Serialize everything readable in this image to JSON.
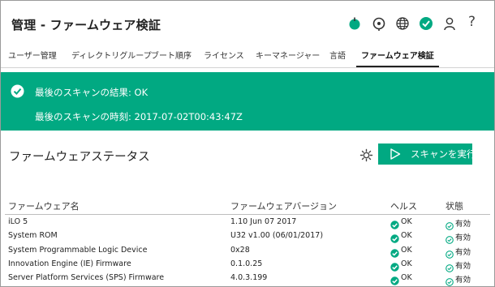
{
  "header": {
    "title": "管理 - ファームウェア検証",
    "icons": [
      "power-icon",
      "uid-indicator-icon",
      "language-globe-icon",
      "health-ok-icon",
      "user-icon",
      "help-icon"
    ],
    "help_label": "?"
  },
  "tabs": [
    {
      "label": "ユーザー管理",
      "active": false
    },
    {
      "label": "ディレクトリグループ",
      "active": false
    },
    {
      "label": "ブート順序",
      "active": false
    },
    {
      "label": "ライセンス",
      "active": false
    },
    {
      "label": "キーマネージャー",
      "active": false
    },
    {
      "label": "言語",
      "active": false
    },
    {
      "label": "ファームウェア検証",
      "active": true
    }
  ],
  "banner": {
    "result_label": "最後のスキャンの結果",
    "result_value": "OK",
    "time_label": "最後のスキャンの時刻",
    "time_value": "2017-07-02T00:43:47Z",
    "result_line": "最後のスキャンの結果: OK",
    "time_line": "最後のスキャンの時刻: 2017-07-02T00:43:47Z"
  },
  "status": {
    "title": "ファームウェアステータス",
    "scan_button": "スキャンを実行"
  },
  "table": {
    "columns": [
      "ファームウェア名",
      "ファームウェアバージョン",
      "ヘルス",
      "状態"
    ],
    "rows": [
      {
        "name": "iLO 5",
        "version": "1.10 Jun 07 2017",
        "health": "OK",
        "state": "有効"
      },
      {
        "name": "System ROM",
        "version": "U32 v1.00 (06/01/2017)",
        "health": "OK",
        "state": "有効"
      },
      {
        "name": "System Programmable Logic Device",
        "version": "0x28",
        "health": "OK",
        "state": "有効"
      },
      {
        "name": "Innovation Engine (IE) Firmware",
        "version": "0.1.0.25",
        "health": "OK",
        "state": "有効"
      },
      {
        "name": "Server Platform Services (SPS) Firmware",
        "version": "4.0.3.199",
        "health": "OK",
        "state": "有効"
      }
    ]
  },
  "colors": {
    "accent": "#01a982",
    "text": "#222222",
    "rule": "#d2d2d2"
  }
}
